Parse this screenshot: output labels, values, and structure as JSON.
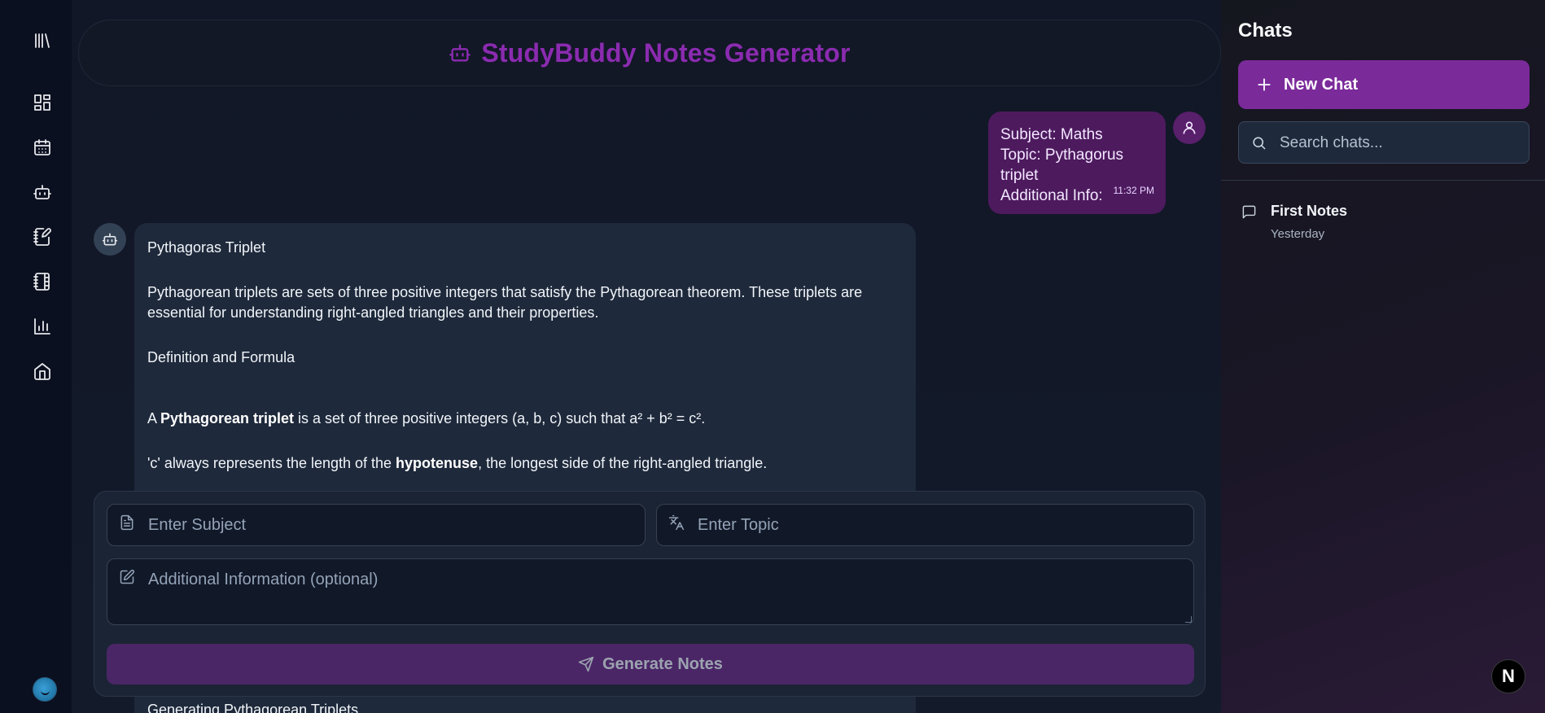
{
  "header": {
    "title": "StudyBuddy Notes Generator",
    "icon": "bot-icon"
  },
  "rail": {
    "items": [
      {
        "icon": "library-icon"
      },
      {
        "icon": "dashboard-icon"
      },
      {
        "icon": "calendar-icon"
      },
      {
        "icon": "bot-icon"
      },
      {
        "icon": "notebook-pen-icon"
      },
      {
        "icon": "notebook-tabs-icon"
      },
      {
        "icon": "bar-chart-icon"
      },
      {
        "icon": "home-icon"
      }
    ]
  },
  "user_message": {
    "subject": "Subject: Maths",
    "topic": "Topic: Pythagorus triplet",
    "info": "Additional Info:",
    "time": "11:32 PM"
  },
  "bot_message": {
    "heading": "Pythagoras Triplet",
    "intro": "Pythagorean triplets are sets of three positive integers that satisfy the Pythagorean theorem. These triplets are essential for understanding right-angled triangles and their properties.",
    "section": "Definition and Formula",
    "def_pre": "A ",
    "def_bold": "Pythagorean triplet",
    "def_post": " is a set of three positive integers (a, b, c) such that a² + b² = c².",
    "c_pre": "'c' always represents the length of the ",
    "c_bold": "hypotenuse",
    "c_post": ", the longest side of the right-angled triangle.",
    "tail": "Generating Pythagorean Triplets"
  },
  "form": {
    "subject_placeholder": "Enter Subject",
    "topic_placeholder": "Enter Topic",
    "info_placeholder": "Additional Information (optional)",
    "generate_label": "Generate Notes"
  },
  "sidebar": {
    "title": "Chats",
    "new_chat_label": "New Chat",
    "search_placeholder": "Search chats...",
    "chats": [
      {
        "name": "First Notes",
        "date": "Yesterday"
      }
    ]
  },
  "badge": "N",
  "colors": {
    "accent": "#7b2a9a",
    "title": "#8b2bb0",
    "user_bubble": "#4d1a5e",
    "bot_bubble": "#1e293b"
  }
}
